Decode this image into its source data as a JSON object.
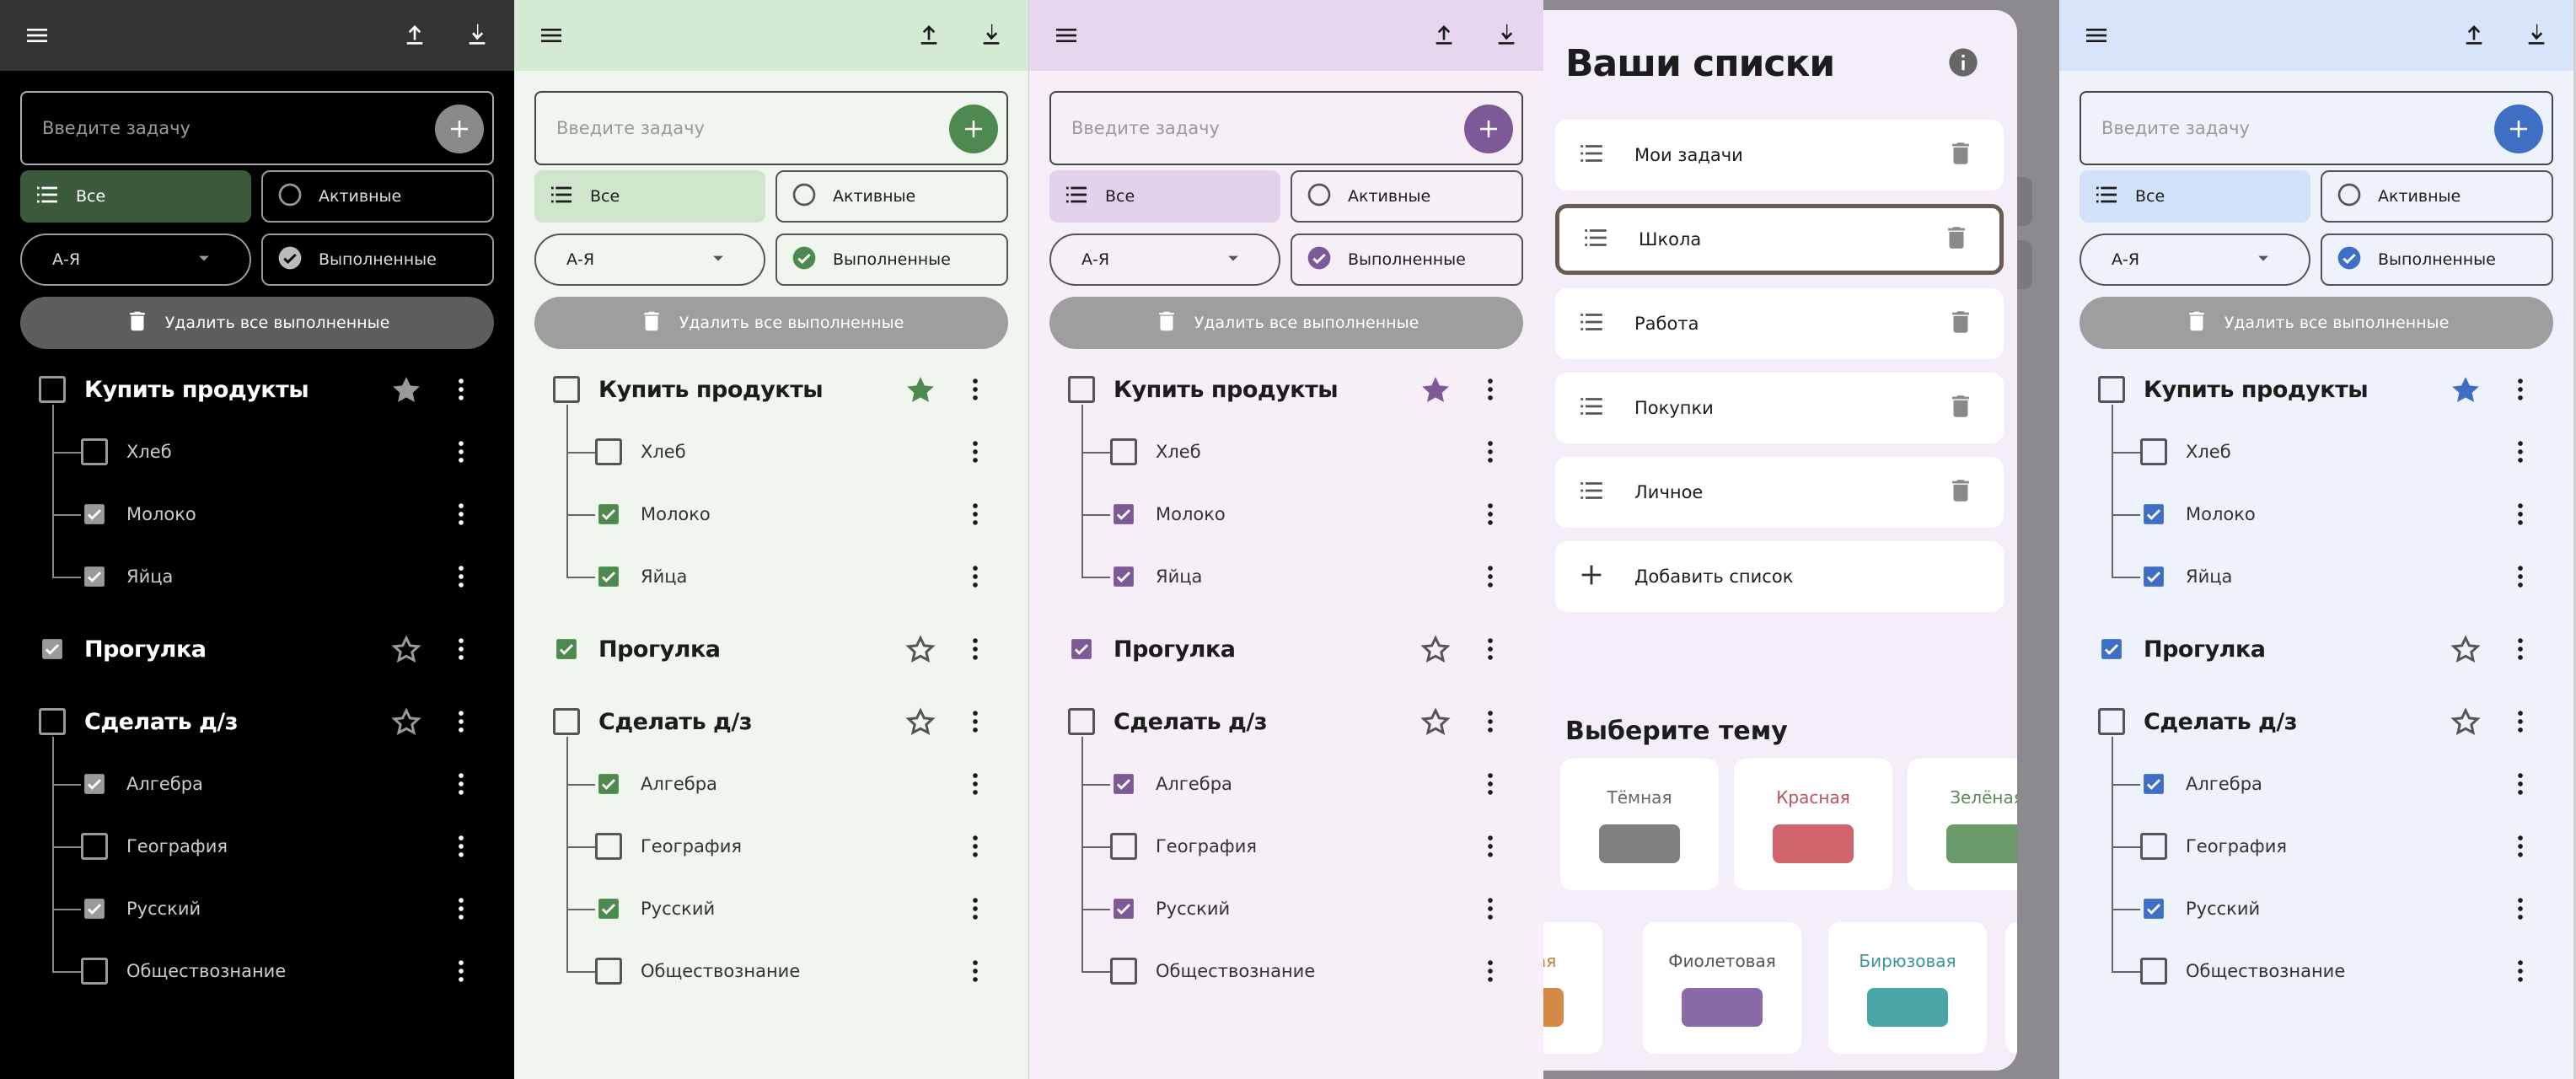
{
  "app": {
    "input_placeholder": "Введите задачу",
    "filter_all": "Все",
    "filter_active": "Активные",
    "sort_label": "А-Я",
    "filter_done": "Выполненные",
    "delete_done": "Удалить все выполненные"
  },
  "tasks": [
    {
      "title": "Купить продукты",
      "checked": false,
      "starred": true,
      "children": [
        {
          "title": "Хлеб",
          "checked": false
        },
        {
          "title": "Молоко",
          "checked": true
        },
        {
          "title": "Яйца",
          "checked": true
        }
      ]
    },
    {
      "title": "Прогулка",
      "checked": true,
      "starred": false,
      "children": []
    },
    {
      "title": "Сделать д/з",
      "checked": false,
      "starred": false,
      "children": [
        {
          "title": "Алгебра",
          "checked": true
        },
        {
          "title": "География",
          "checked": false
        },
        {
          "title": "Русский",
          "checked": true
        },
        {
          "title": "Обществознание",
          "checked": false
        }
      ]
    }
  ],
  "themes_panels": [
    {
      "key": "dark",
      "accent": "#3b5a3c",
      "check": "#9a9a9a",
      "add": "#8a8a8a"
    },
    {
      "key": "green",
      "accent": "#4e8a4f",
      "check": "#4e8a4f",
      "add": "#4e8a4f"
    },
    {
      "key": "purple",
      "accent": "#7d5a97",
      "check": "#7d5a97",
      "add": "#7d5a97"
    },
    {
      "key": "blue",
      "accent": "#3f6fc5",
      "check": "#3f6fc5",
      "add": "#3f6fc5"
    }
  ],
  "dialog": {
    "title": "Ваши списки",
    "lists": [
      "Мои задачи",
      "Школа",
      "Работа",
      "Покупки",
      "Личное"
    ],
    "selected_index": 1,
    "add_list": "Добавить список",
    "theme_title": "Выберите тему",
    "themes_row1": [
      {
        "name": "Тёмная",
        "color": "#808080",
        "text_color": "#666"
      },
      {
        "name": "Красная",
        "color": "#d0646c",
        "text_color": "#c0505a"
      },
      {
        "name": "Зелёная",
        "color": "#6a9a6a",
        "text_color": "#5a8a5a"
      }
    ],
    "themes_row2": [
      {
        "name": "Оранжевая",
        "label": "ажевая",
        "color": "#d48a44",
        "text_color": "#c57a35"
      },
      {
        "name": "Фиолетовая",
        "color": "#8a6aa6",
        "text_color": "#555"
      },
      {
        "name": "Бирюзовая",
        "color": "#4aa6a6",
        "text_color": "#3a9696"
      }
    ]
  }
}
